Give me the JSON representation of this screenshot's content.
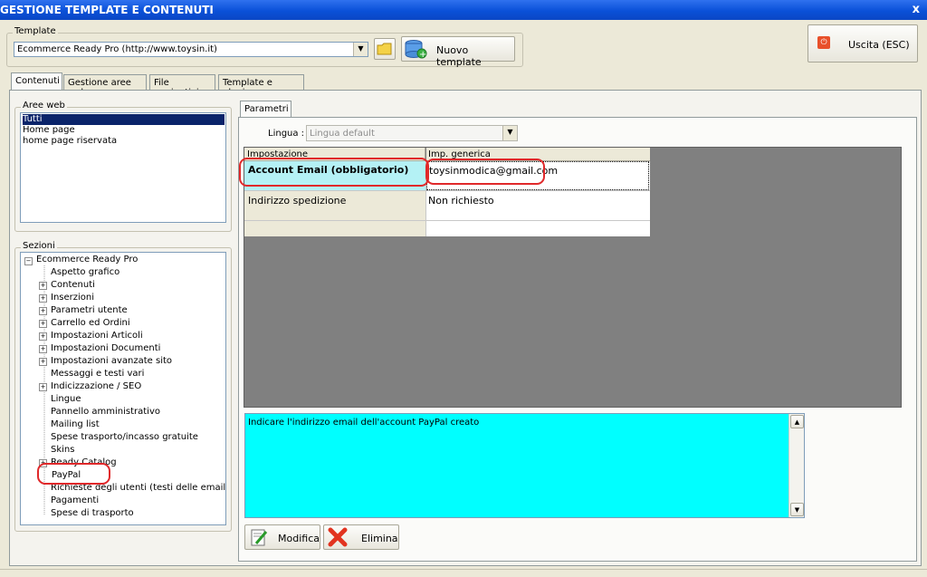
{
  "window": {
    "title": "GESTIONE TEMPLATE E CONTENUTI",
    "close": "x"
  },
  "template": {
    "group_label": "Template",
    "selected": "Ecommerce Ready Pro (http://www.toysin.it)",
    "new_button": "Nuovo template"
  },
  "exit_button": "Uscita (ESC)",
  "tabs": [
    "Contenuti",
    "Gestione aree web",
    "File aggiuntivi",
    "Template e plugins"
  ],
  "aree_web": {
    "label": "Aree web",
    "items": [
      "Tutti",
      "Home page",
      "home page riservata"
    ]
  },
  "sezioni": {
    "label": "Sezioni",
    "root": "Ecommerce Ready Pro",
    "items": [
      {
        "label": "Aspetto grafico",
        "expand": false
      },
      {
        "label": "Contenuti",
        "expand": true
      },
      {
        "label": "Inserzioni",
        "expand": true
      },
      {
        "label": "Parametri utente",
        "expand": true
      },
      {
        "label": "Carrello ed Ordini",
        "expand": true
      },
      {
        "label": "Impostazioni Articoli",
        "expand": true
      },
      {
        "label": "Impostazioni Documenti",
        "expand": true
      },
      {
        "label": "Impostazioni avanzate sito",
        "expand": true
      },
      {
        "label": "Messaggi e testi vari",
        "expand": false
      },
      {
        "label": "Indicizzazione / SEO",
        "expand": true
      },
      {
        "label": "Lingue",
        "expand": false
      },
      {
        "label": "Pannello amministrativo",
        "expand": false
      },
      {
        "label": "Mailing list",
        "expand": false
      },
      {
        "label": "Spese trasporto/incasso gratuite",
        "expand": false
      },
      {
        "label": "Skins",
        "expand": false
      },
      {
        "label": "Ready Catalog",
        "expand": true
      },
      {
        "label": "PayPal",
        "expand": false,
        "selected": true
      },
      {
        "label": "Richieste degli utenti (testi delle email)",
        "expand": false
      },
      {
        "label": "Pagamenti",
        "expand": false
      },
      {
        "label": "Spese di trasporto",
        "expand": false
      }
    ]
  },
  "parametri": {
    "tab": "Parametri",
    "lingua_label": "Lingua :",
    "lingua_value": "Lingua default",
    "col_setting": "Impostazione",
    "col_value": "Imp. generica",
    "rows": [
      {
        "setting": "Account Email (obbligatorio)",
        "value": "toysinmodica@gmail.com"
      },
      {
        "setting": "Indirizzo spedizione",
        "value": "Non richiesto"
      }
    ],
    "description": "Indicare l'indirizzo email dell'account PayPal creato"
  },
  "actions": {
    "edit": "Modifica",
    "delete": "Elimina"
  },
  "colors": {
    "accent_cyan": "#00ffff",
    "selection": "#0a246a",
    "grid_bg": "#808080",
    "highlight_red": "#e0282a"
  }
}
